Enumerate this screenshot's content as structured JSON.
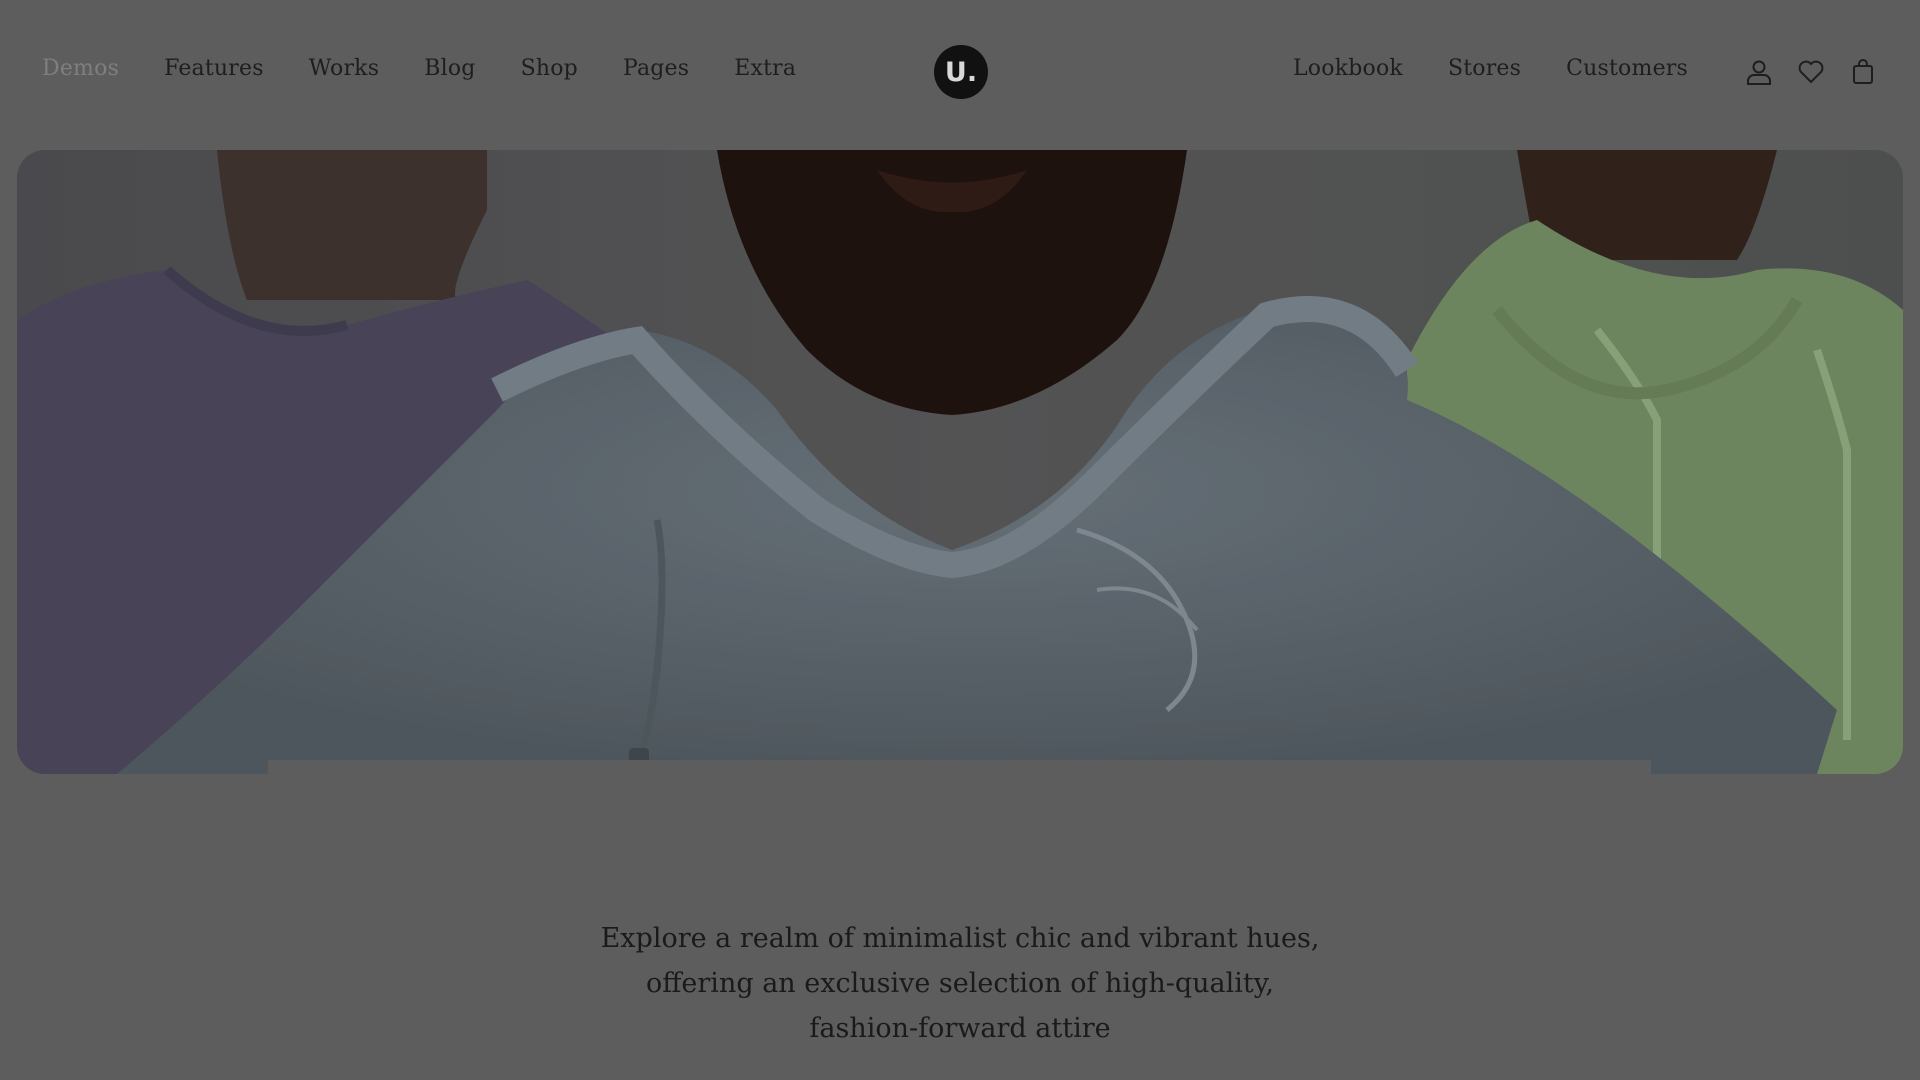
{
  "nav_left": [
    {
      "label": "Demos",
      "active": true
    },
    {
      "label": "Features"
    },
    {
      "label": "Works"
    },
    {
      "label": "Blog"
    },
    {
      "label": "Shop"
    },
    {
      "label": "Pages"
    },
    {
      "label": "Extra"
    }
  ],
  "logo": {
    "text": "U."
  },
  "nav_right": [
    {
      "label": "Lookbook"
    },
    {
      "label": "Stores"
    },
    {
      "label": "Customers"
    }
  ],
  "header_icons": [
    "user-icon",
    "heart-icon",
    "bag-icon"
  ],
  "hero": {
    "overlay_color": "#000000",
    "colors": {
      "left_shirt": "#5a5468",
      "center_hoodie": "#7d8a95",
      "right_hoodie": "#8fb07a",
      "skin_dark": "#2a1a14",
      "background": "#6b6b6b"
    }
  },
  "tagline": {
    "line1": "Explore a realm of minimalist chic and vibrant hues,",
    "line2": "offering an exclusive selection of high-quality,",
    "line3": "fashion-forward attire"
  }
}
